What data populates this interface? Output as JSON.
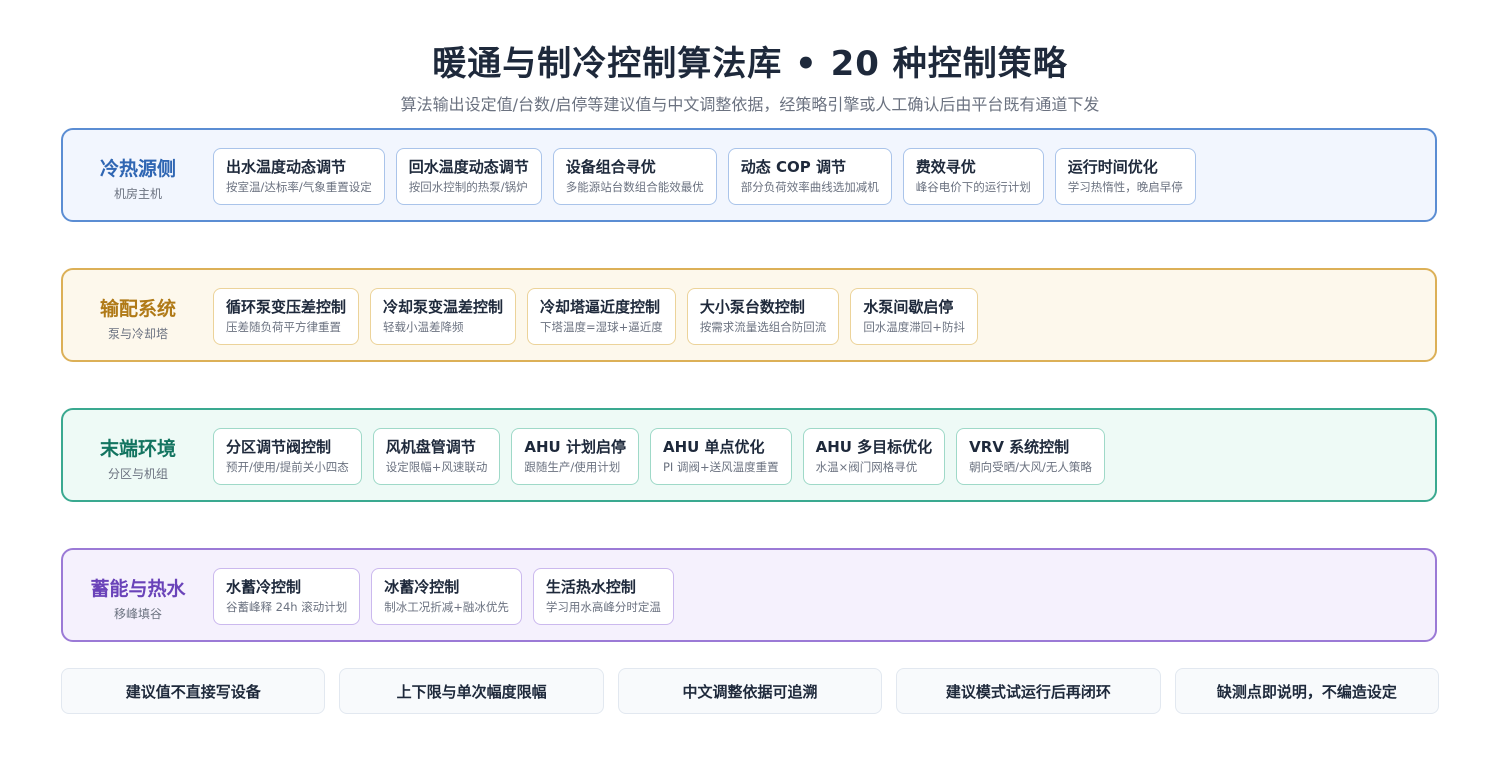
{
  "title": "暖通与制冷控制算法库 • 20 种控制策略",
  "subtitle": "算法输出设定值/台数/启停等建议值与中文调整依据，经策略引擎或人工确认后由平台既有通道下发",
  "sections": [
    {
      "title": "冷热源侧",
      "sub": "机房主机",
      "color": "#2f66b3",
      "cards": [
        {
          "title": "出水温度动态调节",
          "desc": "按室温/达标率/气象重置设定"
        },
        {
          "title": "回水温度动态调节",
          "desc": "按回水控制的热泵/锅炉"
        },
        {
          "title": "设备组合寻优",
          "desc": "多能源站台数组合能效最优"
        },
        {
          "title": "动态 COP 调节",
          "desc": "部分负荷效率曲线选加减机"
        },
        {
          "title": "费效寻优",
          "desc": "峰谷电价下的运行计划"
        },
        {
          "title": "运行时间优化",
          "desc": "学习热惰性，晚启早停"
        }
      ]
    },
    {
      "title": "输配系统",
      "sub": "泵与冷却塔",
      "color": "#b07a17",
      "cards": [
        {
          "title": "循环泵变压差控制",
          "desc": "压差随负荷平方律重置"
        },
        {
          "title": "冷却泵变温差控制",
          "desc": "轻载小温差降频"
        },
        {
          "title": "冷却塔逼近度控制",
          "desc": "下塔温度=湿球+逼近度"
        },
        {
          "title": "大小泵台数控制",
          "desc": "按需求流量选组合防回流"
        },
        {
          "title": "水泵间歇启停",
          "desc": "回水温度滞回+防抖"
        }
      ]
    },
    {
      "title": "末端环境",
      "sub": "分区与机组",
      "color": "#137460",
      "cards": [
        {
          "title": "分区调节阀控制",
          "desc": "预开/使用/提前关小四态"
        },
        {
          "title": "风机盘管调节",
          "desc": "设定限幅+风速联动"
        },
        {
          "title": "AHU 计划启停",
          "desc": "跟随生产/使用计划"
        },
        {
          "title": "AHU 单点优化",
          "desc": "PI 调阀+送风温度重置"
        },
        {
          "title": "AHU 多目标优化",
          "desc": "水温×阀门网格寻优"
        },
        {
          "title": "VRV 系统控制",
          "desc": "朝向受晒/大风/无人策略"
        }
      ]
    },
    {
      "title": "蓄能与热水",
      "sub": "移峰填谷",
      "color": "#6a43b9",
      "cards": [
        {
          "title": "水蓄冷控制",
          "desc": "谷蓄峰释 24h 滚动计划"
        },
        {
          "title": "冰蓄冷控制",
          "desc": "制冰工况折减+融冰优先"
        },
        {
          "title": "生活热水控制",
          "desc": "学习用水高峰分时定温"
        }
      ]
    }
  ],
  "footer": [
    "建议值不直接写设备",
    "上下限与单次幅度限幅",
    "中文调整依据可追溯",
    "建议模式试运行后再闭环",
    "缺测点即说明，不编造设定"
  ]
}
